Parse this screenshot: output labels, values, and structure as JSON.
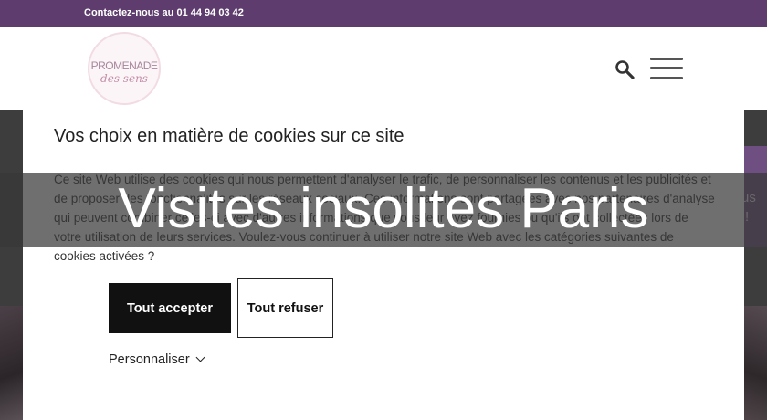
{
  "topbar": {
    "contact": "Contactez-nous au 01 44 94 03 42"
  },
  "header": {
    "logo": {
      "line1": "PROMENADE",
      "line2": "des sens"
    },
    "icons": {
      "search": "search-icon",
      "menu": "hamburger-menu-icon"
    }
  },
  "side_tab": {
    "text1": "us",
    "text2": "!"
  },
  "cookie_modal": {
    "title": "Vos choix en matière de cookies sur ce site",
    "description": "Ce site Web utilise des cookies qui nous permettent d'analyser le trafic, de personnaliser les contenus et les publicités et de proposer des fonctionnalités sur les réseaux sociaux. Ces informations sont partagées avec nos partenaires d'analyse qui peuvent combiner celles-ci avec d'autres informations que vous leur avez fournies ou qu'ils ont collectées lors de votre utilisation de leurs services. Voulez-vous continuer à utiliser notre site Web avec les catégories suivantes de cookies activées ?",
    "accept_label": "Tout accepter",
    "refuse_label": "Tout refuser",
    "customize_label": "Personnaliser"
  },
  "overlay": {
    "title": "Visites insolites Paris"
  },
  "colors": {
    "topbar": "#5e3d6e",
    "accent_tab": "#6f4f82",
    "accept_button": "#111111"
  }
}
